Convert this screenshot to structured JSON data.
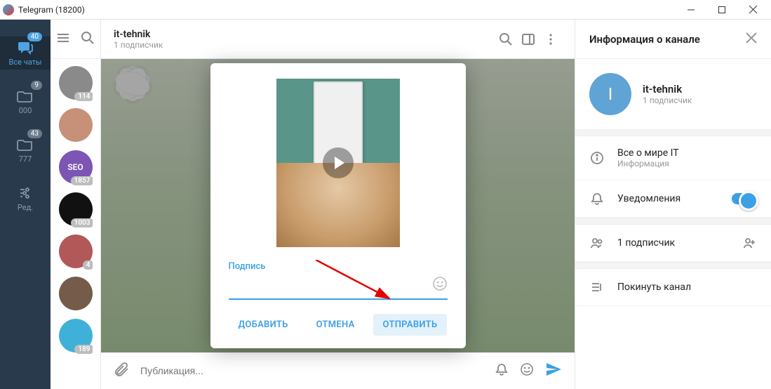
{
  "window": {
    "title": "Telegram (18200)"
  },
  "left_tabs": [
    {
      "label": "Все чаты",
      "badge": "40"
    },
    {
      "label": "000",
      "badge": "9"
    },
    {
      "label": "777",
      "badge": "43"
    },
    {
      "label": "Ред."
    }
  ],
  "chats": [
    {
      "bg": "#8a8a8a",
      "text": "",
      "count": "114"
    },
    {
      "bg": "#c79078",
      "text": "",
      "count": ""
    },
    {
      "bg": "#7c55b5",
      "text": "SEO",
      "count": "1857"
    },
    {
      "bg": "#111111",
      "text": "",
      "count": "1003"
    },
    {
      "bg": "#b25858",
      "text": "",
      "count": "4"
    },
    {
      "bg": "#745b4a",
      "text": "",
      "count": ""
    },
    {
      "bg": "#3fb1d8",
      "text": "",
      "count": "189"
    }
  ],
  "conv": {
    "name": "it-tehnik",
    "sub": "1 подписчик",
    "input_placeholder": "Публикация..."
  },
  "modal": {
    "caption_label": "Подпись",
    "add": "ДОБАВИТЬ",
    "cancel": "ОТМЕНА",
    "send": "ОТПРАВИТЬ"
  },
  "rpanel": {
    "title": "Информация о канале",
    "name": "it-tehnik",
    "initial": "I",
    "sub": "1 подписчик",
    "info_title": "Все о мире IT",
    "info_sub": "Информация",
    "notifications": "Уведомления",
    "subscribers": "1 подписчик",
    "leave": "Покинуть канал"
  }
}
